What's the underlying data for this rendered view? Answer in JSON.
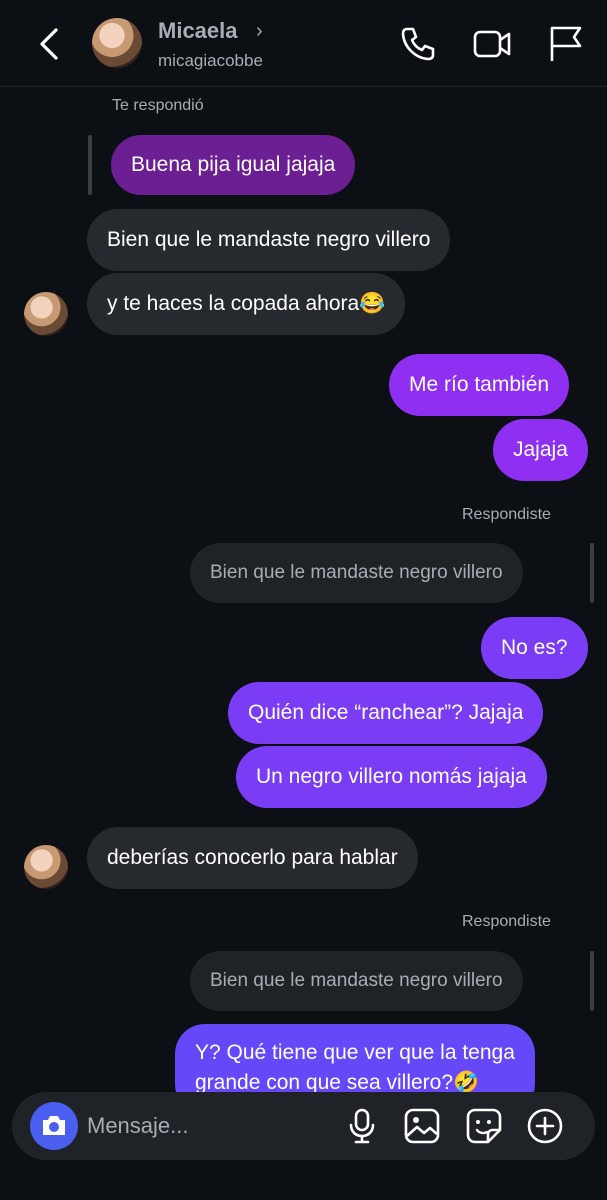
{
  "header": {
    "name": "Micaela",
    "username": "micagiacobbe"
  },
  "messages": {
    "label_replied_to_you": "Te respondió",
    "reply_quote_1": "Buena pija igual jajaja",
    "in_1": "Bien que le mandaste negro villero",
    "in_2": "y te haces la copada ahora😂",
    "out_1": "Me río también",
    "out_2": "Jajaja",
    "label_you_replied_1": "Respondiste",
    "quote_1": "Bien que le mandaste negro villero",
    "out_3": "No es?",
    "out_4": "Quién dice “ranchear”? Jajaja",
    "out_5": "Un negro villero nomás jajaja",
    "in_3": "deberías conocerlo para hablar",
    "label_you_replied_2": "Respondiste",
    "quote_2": "Bien que le mandaste negro villero",
    "out_6_line1": "Y? Qué tiene que ver que la tenga",
    "out_6_line2": "grande con que sea villero?🤣"
  },
  "composer": {
    "placeholder": "Mensaje..."
  },
  "colors": {
    "background": "#0c1014",
    "incoming_bubble": "#262a2f",
    "outgoing_violet": "#8e2ff2",
    "outgoing_blue": "#6548f8",
    "camera_button": "#4a5ef0"
  },
  "icons": [
    "back-arrow-icon",
    "phone-icon",
    "video-camera-icon",
    "flag-icon",
    "camera-icon",
    "microphone-icon",
    "gallery-icon",
    "sticker-icon",
    "plus-icon"
  ]
}
